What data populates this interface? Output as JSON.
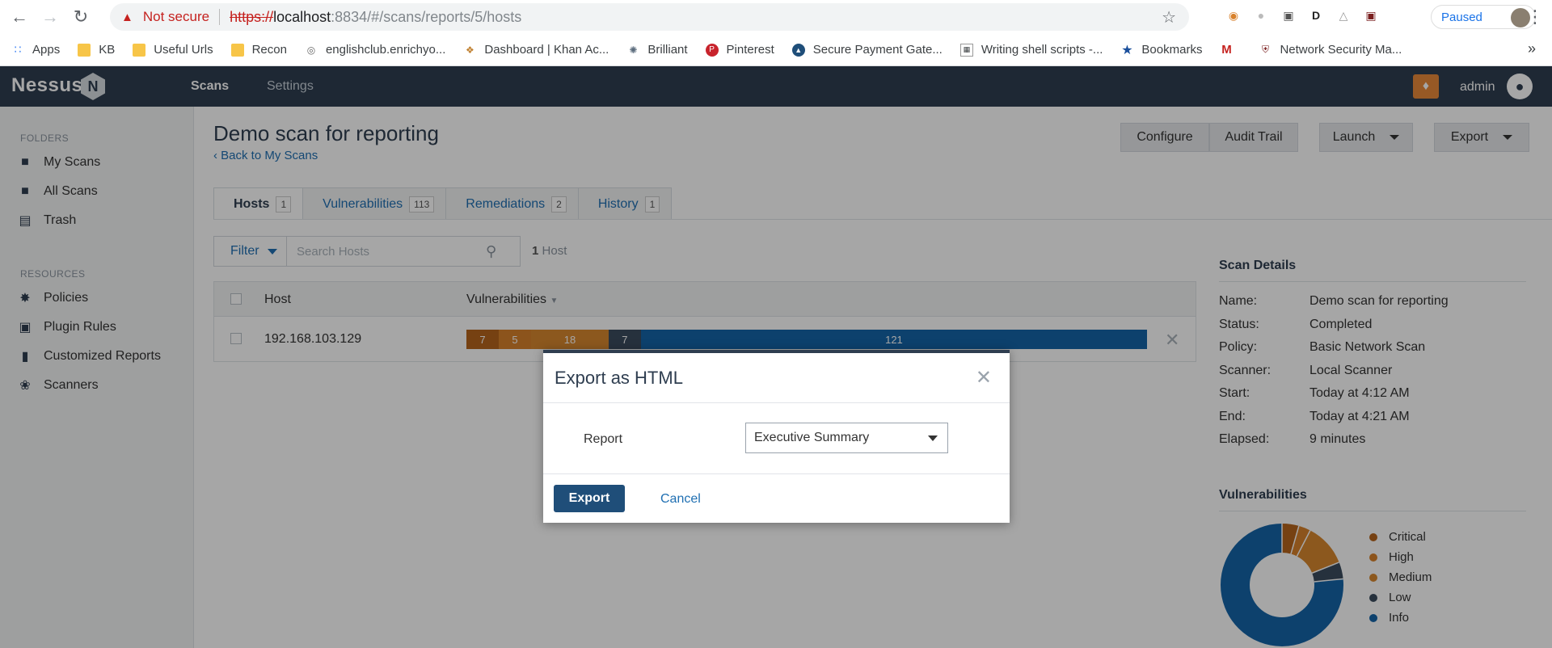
{
  "browser": {
    "security_label": "Not secure",
    "url_scheme": "https://",
    "url_host": "localhost",
    "url_path": ":8834/#/scans/reports/5/hosts",
    "paused_label": "Paused"
  },
  "bookmarks": [
    {
      "label": "Apps",
      "icon": "apps-grid-icon"
    },
    {
      "label": "KB",
      "icon": "folder-icon"
    },
    {
      "label": "Useful Urls",
      "icon": "folder-icon"
    },
    {
      "label": "Recon",
      "icon": "folder-icon"
    },
    {
      "label": "englishclub.enrichyo...",
      "icon": "globe-icon"
    },
    {
      "label": "Dashboard | Khan Ac...",
      "icon": "khan-icon"
    },
    {
      "label": "Brilliant",
      "icon": "brilliant-icon"
    },
    {
      "label": "Pinterest",
      "icon": "pinterest-icon"
    },
    {
      "label": "Secure Payment Gate...",
      "icon": "payment-icon"
    },
    {
      "label": "Writing shell scripts -...",
      "icon": "doc-icon"
    },
    {
      "label": "Bookmarks",
      "icon": "star-icon"
    },
    {
      "label": "",
      "icon": "gmail-icon"
    },
    {
      "label": "Network Security Ma...",
      "icon": "shield-icon"
    }
  ],
  "app": {
    "logo": "Nessus",
    "logo_badge": "N",
    "nav": {
      "scans": "Scans",
      "settings": "Settings"
    },
    "user": "admin"
  },
  "sidebar": {
    "folders_heading": "FOLDERS",
    "folders": [
      {
        "label": "My Scans",
        "icon": "folder-icon"
      },
      {
        "label": "All Scans",
        "icon": "folder-icon"
      },
      {
        "label": "Trash",
        "icon": "trash-icon"
      }
    ],
    "resources_heading": "RESOURCES",
    "resources": [
      {
        "label": "Policies",
        "icon": "policy-icon"
      },
      {
        "label": "Plugin Rules",
        "icon": "plugin-icon"
      },
      {
        "label": "Customized Reports",
        "icon": "report-icon"
      },
      {
        "label": "Scanners",
        "icon": "scanner-icon"
      }
    ]
  },
  "page": {
    "title": "Demo scan for reporting",
    "back_link": "Back to My Scans",
    "buttons": {
      "configure": "Configure",
      "audit_trail": "Audit Trail",
      "launch": "Launch",
      "export": "Export"
    }
  },
  "tabs": [
    {
      "label": "Hosts",
      "count": "1",
      "active": true
    },
    {
      "label": "Vulnerabilities",
      "count": "113",
      "active": false
    },
    {
      "label": "Remediations",
      "count": "2",
      "active": false
    },
    {
      "label": "History",
      "count": "1",
      "active": false
    }
  ],
  "filter": {
    "label": "Filter",
    "search_placeholder": "Search Hosts",
    "count_number": "1",
    "count_label": "Host"
  },
  "table": {
    "col_host": "Host",
    "col_vulns": "Vulnerabilities",
    "rows": [
      {
        "host": "192.168.103.129",
        "segments": [
          {
            "severity": "critical",
            "value": 7,
            "color": "#b5651d"
          },
          {
            "severity": "high",
            "value": 5,
            "color": "#d8812b"
          },
          {
            "severity": "medium",
            "value": 18,
            "color": "#d8872f"
          },
          {
            "severity": "low",
            "value": 7,
            "color": "#3b4c5e"
          },
          {
            "severity": "info",
            "value": 121,
            "color": "#1565a8"
          }
        ]
      }
    ]
  },
  "scan_details": {
    "title": "Scan Details",
    "rows": [
      {
        "label": "Name:",
        "value": "Demo scan for reporting"
      },
      {
        "label": "Status:",
        "value": "Completed"
      },
      {
        "label": "Policy:",
        "value": "Basic Network Scan"
      },
      {
        "label": "Scanner:",
        "value": "Local Scanner"
      },
      {
        "label": "Start:",
        "value": "Today at 4:12 AM"
      },
      {
        "label": "End:",
        "value": "Today at 4:21 AM"
      },
      {
        "label": "Elapsed:",
        "value": "9 minutes"
      }
    ]
  },
  "vulnerabilities_panel": {
    "title": "Vulnerabilities",
    "legend": [
      {
        "label": "Critical",
        "color": "#b5651d",
        "value": 7
      },
      {
        "label": "High",
        "color": "#d8812b",
        "value": 5
      },
      {
        "label": "Medium",
        "color": "#d8872f",
        "value": 18
      },
      {
        "label": "Low",
        "color": "#3b4c5e",
        "value": 7
      },
      {
        "label": "Info",
        "color": "#1565a8",
        "value": 121
      }
    ]
  },
  "modal": {
    "title": "Export as HTML",
    "report_label": "Report",
    "report_selected": "Executive Summary",
    "export_button": "Export",
    "cancel_link": "Cancel"
  }
}
